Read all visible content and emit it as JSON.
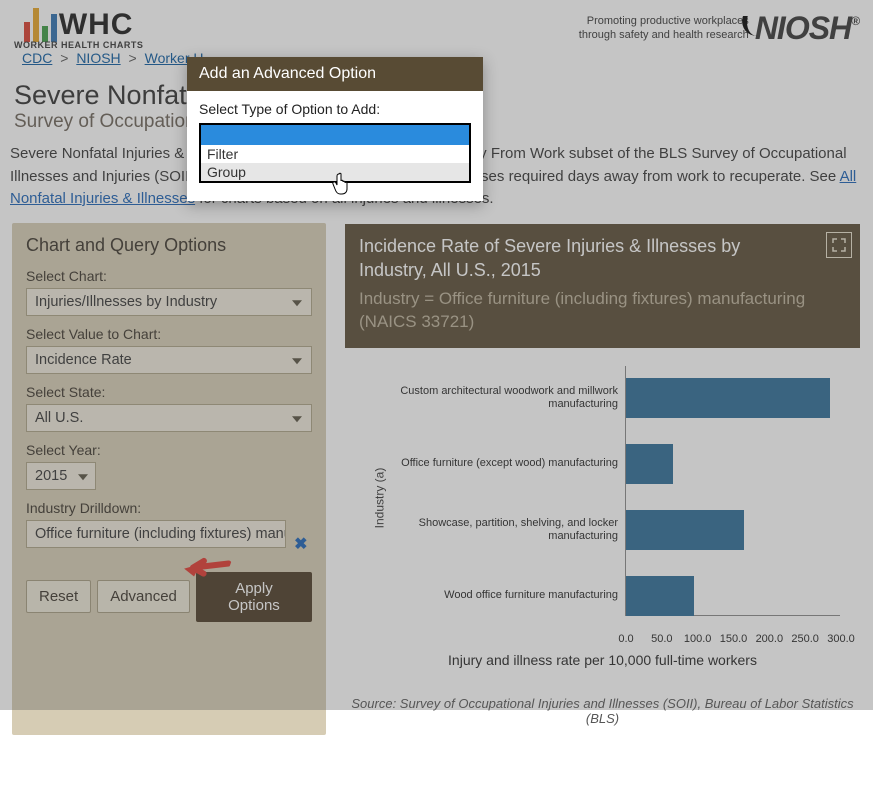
{
  "header": {
    "logo_text": "WHC",
    "logo_sub": "WORKER HEALTH CHARTS",
    "niosh_tag_line1": "Promoting productive workplaces",
    "niosh_tag_line2": "through safety and health research",
    "niosh_logo": "NIOSH"
  },
  "breadcrumb": {
    "items": [
      "CDC",
      "NIOSH",
      "Worker H"
    ],
    "sep": ">"
  },
  "page": {
    "title": "Severe Nonfatal I",
    "subtitle": "Survey of Occupation                                                                                                      Statistics (BLS)",
    "intro_a": "Severe Nonfatal Injuries & Illnesses charts are based on the Days Away From Work subset of the BLS Survey of Occupational Illnesses and Injuries (SOII) where the severity of the injuries and illnesses required days away from work to recuperate. See ",
    "intro_link": "All Nonfatal Injuries & Illnesses",
    "intro_b": " for charts based on all injuries and illnesses."
  },
  "panel": {
    "heading": "Chart and Query Options",
    "select_chart_label": "Select Chart:",
    "select_chart_value": "Injuries/Illnesses by Industry",
    "select_value_label": "Select Value to Chart:",
    "select_value_value": "Incidence Rate",
    "select_state_label": "Select State:",
    "select_state_value": "All U.S.",
    "select_year_label": "Select Year:",
    "select_year_value": "2015",
    "drilldown_label": "Industry Drilldown:",
    "drilldown_value": "Office furniture (including fixtures) manufactu",
    "reset": "Reset",
    "advanced": "Advanced",
    "apply": "Apply Options"
  },
  "chart": {
    "title": "Incidence Rate of Severe Injuries & Illnesses by Industry, All U.S., 2015",
    "subtitle": "Industry = Office furniture (including fixtures) manufacturing (NAICS 33721)",
    "ylabel": "Industry (a)",
    "xlabel": "Injury and illness rate per 10,000 full-time workers",
    "source": "Source: Survey of Occupational Injuries and Illnesses (SOII), Bureau of Labor Statistics (BLS)"
  },
  "chart_data": {
    "type": "bar",
    "orientation": "horizontal",
    "categories": [
      "Custom architectural woodwork and millwork manufacturing",
      "Office furniture (except wood) manufacturing",
      "Showcase, partition, shelving, and locker manufacturing",
      "Wood office furniture manufacturing"
    ],
    "values": [
      285,
      65,
      165,
      95
    ],
    "xlabel": "Injury and illness rate per 10,000 full-time workers",
    "ylabel": "Industry (a)",
    "xlim": [
      0,
      300
    ],
    "xticks": [
      0,
      50,
      100,
      150,
      200,
      250,
      300
    ],
    "xtick_labels": [
      "0.0",
      "50.0",
      "100.0",
      "150.0",
      "200.0",
      "250.0",
      "300.0"
    ]
  },
  "modal": {
    "title": "Add an Advanced Option",
    "label": "Select Type of Option to Add:",
    "selected": "",
    "options": [
      "Filter",
      "Group"
    ]
  }
}
